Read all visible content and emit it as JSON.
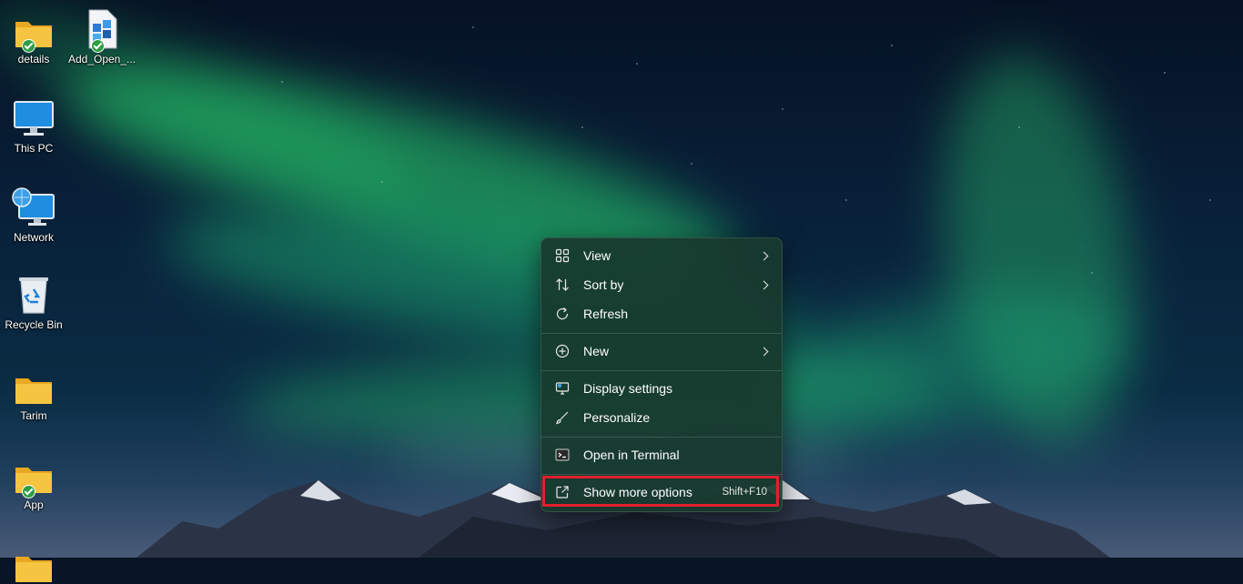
{
  "desktop": {
    "icons": [
      {
        "label": "details",
        "icon": "folder-icon",
        "synced": true
      },
      {
        "label": "Add_Open_...",
        "icon": "registry-file-icon",
        "synced": true
      },
      {
        "label": "This PC",
        "icon": "monitor-icon"
      },
      {
        "label": "Network",
        "icon": "network-icon"
      },
      {
        "label": "Recycle Bin",
        "icon": "recycle-bin-icon"
      },
      {
        "label": "Tarim",
        "icon": "folder-icon"
      },
      {
        "label": "App",
        "icon": "folder-icon",
        "synced": true
      }
    ]
  },
  "context_menu": {
    "items": [
      {
        "label": "View",
        "icon": "grid-icon",
        "submenu": true
      },
      {
        "label": "Sort by",
        "icon": "sort-icon",
        "submenu": true
      },
      {
        "label": "Refresh",
        "icon": "refresh-icon"
      },
      {
        "label": "New",
        "icon": "plus-circle-icon",
        "submenu": true
      },
      {
        "label": "Display settings",
        "icon": "display-icon"
      },
      {
        "label": "Personalize",
        "icon": "brush-icon"
      },
      {
        "label": "Open in Terminal",
        "icon": "terminal-icon"
      },
      {
        "label": "Show more options",
        "icon": "open-external-icon",
        "shortcut": "Shift+F10",
        "highlighted": true
      }
    ]
  },
  "colors": {
    "highlight_border": "#e0202c",
    "check_badge": "#2e9e44",
    "folder": "#f5c542"
  }
}
